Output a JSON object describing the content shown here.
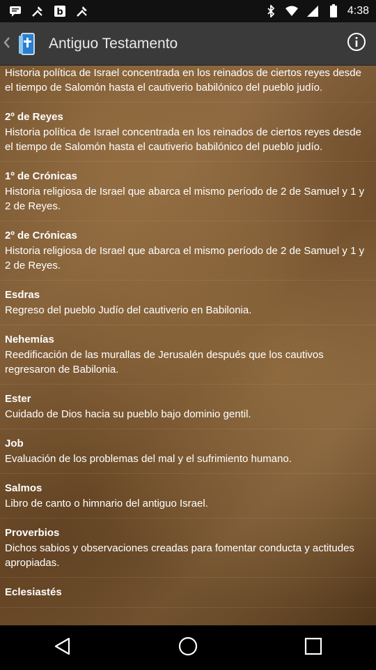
{
  "status_bar": {
    "time": "4:38",
    "left_icons": [
      "message-icon",
      "tools-icon",
      "bold-b-icon",
      "tools-icon"
    ],
    "right_icons": [
      "bluetooth-icon",
      "wifi-icon",
      "signal-icon",
      "battery-icon"
    ]
  },
  "app_bar": {
    "title": "Antiguo Testamento",
    "back_icon": "chevron-left-icon",
    "logo_icon": "bible-book-icon",
    "info_icon": "info-icon"
  },
  "books": [
    {
      "name": "",
      "desc": "Historia política de Israel concentrada en los reinados de ciertos reyes desde el tiempo de Salomón hasta el cautiverio babilónico del pueblo judío."
    },
    {
      "name": "2º de Reyes",
      "desc": "Historia política de Israel concentrada en los reinados de ciertos reyes desde el tiempo de Salomón hasta el cautiverio babilónico del pueblo judío."
    },
    {
      "name": "1º de Crónicas",
      "desc": "Historia religiosa de Israel que abarca el mismo período de 2 de Samuel y 1 y 2 de Reyes."
    },
    {
      "name": "2º de Crónicas",
      "desc": "Historia religiosa de Israel que abarca el mismo período de 2 de Samuel y 1 y 2 de Reyes."
    },
    {
      "name": "Esdras",
      "desc": "Regreso del pueblo Judío del cautiverio en Babilonia."
    },
    {
      "name": "Nehemías",
      "desc": "Reedificación de las murallas de Jerusalén después que los cautivos regresaron de Babilonia."
    },
    {
      "name": "Ester",
      "desc": "Cuidado de Dios hacia su pueblo bajo dominio gentil."
    },
    {
      "name": "Job",
      "desc": "Evaluación de los problemas del mal y el sufrimiento humano."
    },
    {
      "name": "Salmos",
      "desc": "Libro de canto o himnario del antiguo Israel."
    },
    {
      "name": "Proverbios",
      "desc": "Dichos sabios y observaciones creadas para fomentar conducta y actitudes apropiadas."
    },
    {
      "name": "Eclesiastés",
      "desc": ""
    }
  ],
  "nav_bar": {
    "back": "nav-back-icon",
    "home": "nav-home-icon",
    "recents": "nav-recents-icon"
  },
  "colors": {
    "app_bar": "#3a3a3a",
    "status_bar": "#111111",
    "text": "#ffffff",
    "parchment": "#7e5d38"
  }
}
